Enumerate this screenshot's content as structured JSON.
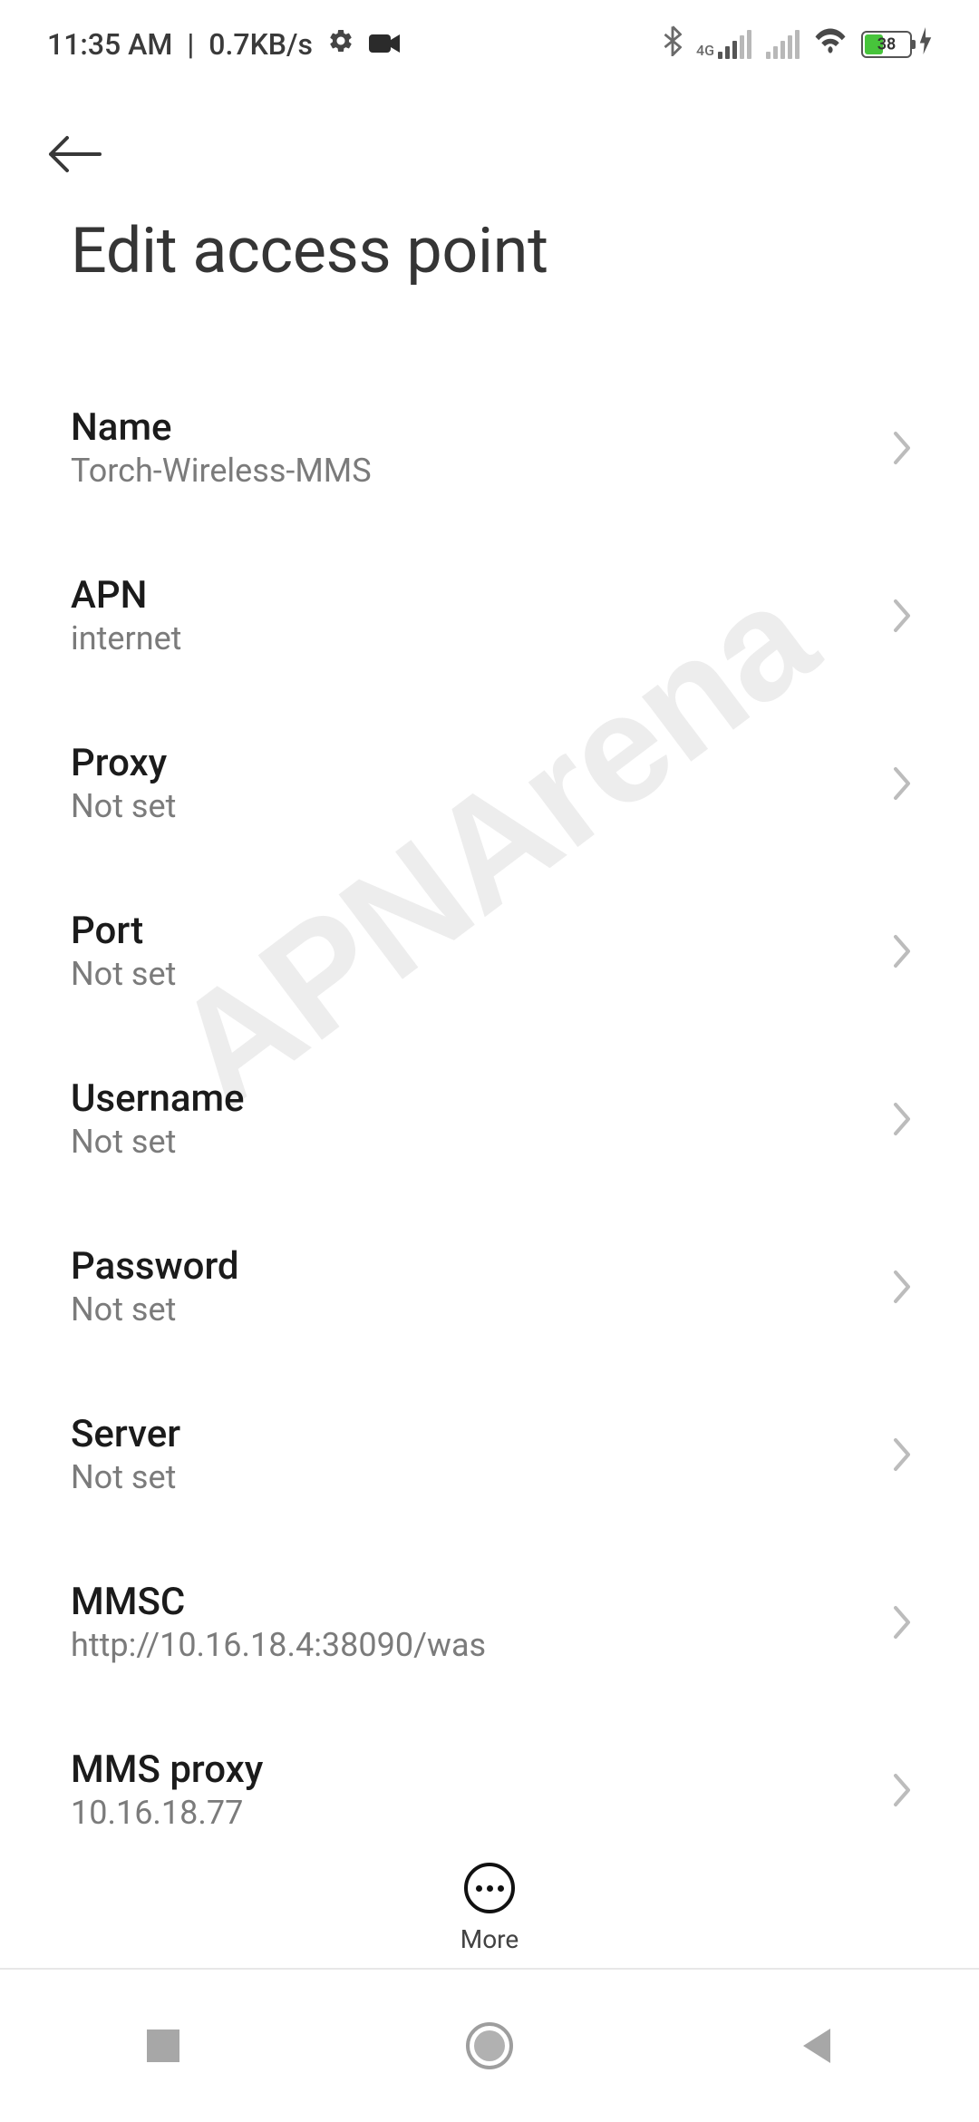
{
  "statusbar": {
    "time": "11:35 AM",
    "speed": "0.7KB/s",
    "network_label": "4G",
    "battery_percent": 38
  },
  "header": {
    "page_title": "Edit access point"
  },
  "settings": [
    {
      "label": "Name",
      "value": "Torch-Wireless-MMS"
    },
    {
      "label": "APN",
      "value": "internet"
    },
    {
      "label": "Proxy",
      "value": "Not set"
    },
    {
      "label": "Port",
      "value": "Not set"
    },
    {
      "label": "Username",
      "value": "Not set"
    },
    {
      "label": "Password",
      "value": "Not set"
    },
    {
      "label": "Server",
      "value": "Not set"
    },
    {
      "label": "MMSC",
      "value": "http://10.16.18.4:38090/was"
    },
    {
      "label": "MMS proxy",
      "value": "10.16.18.77"
    }
  ],
  "actions": {
    "more_label": "More"
  },
  "watermark_text": "APNArena"
}
